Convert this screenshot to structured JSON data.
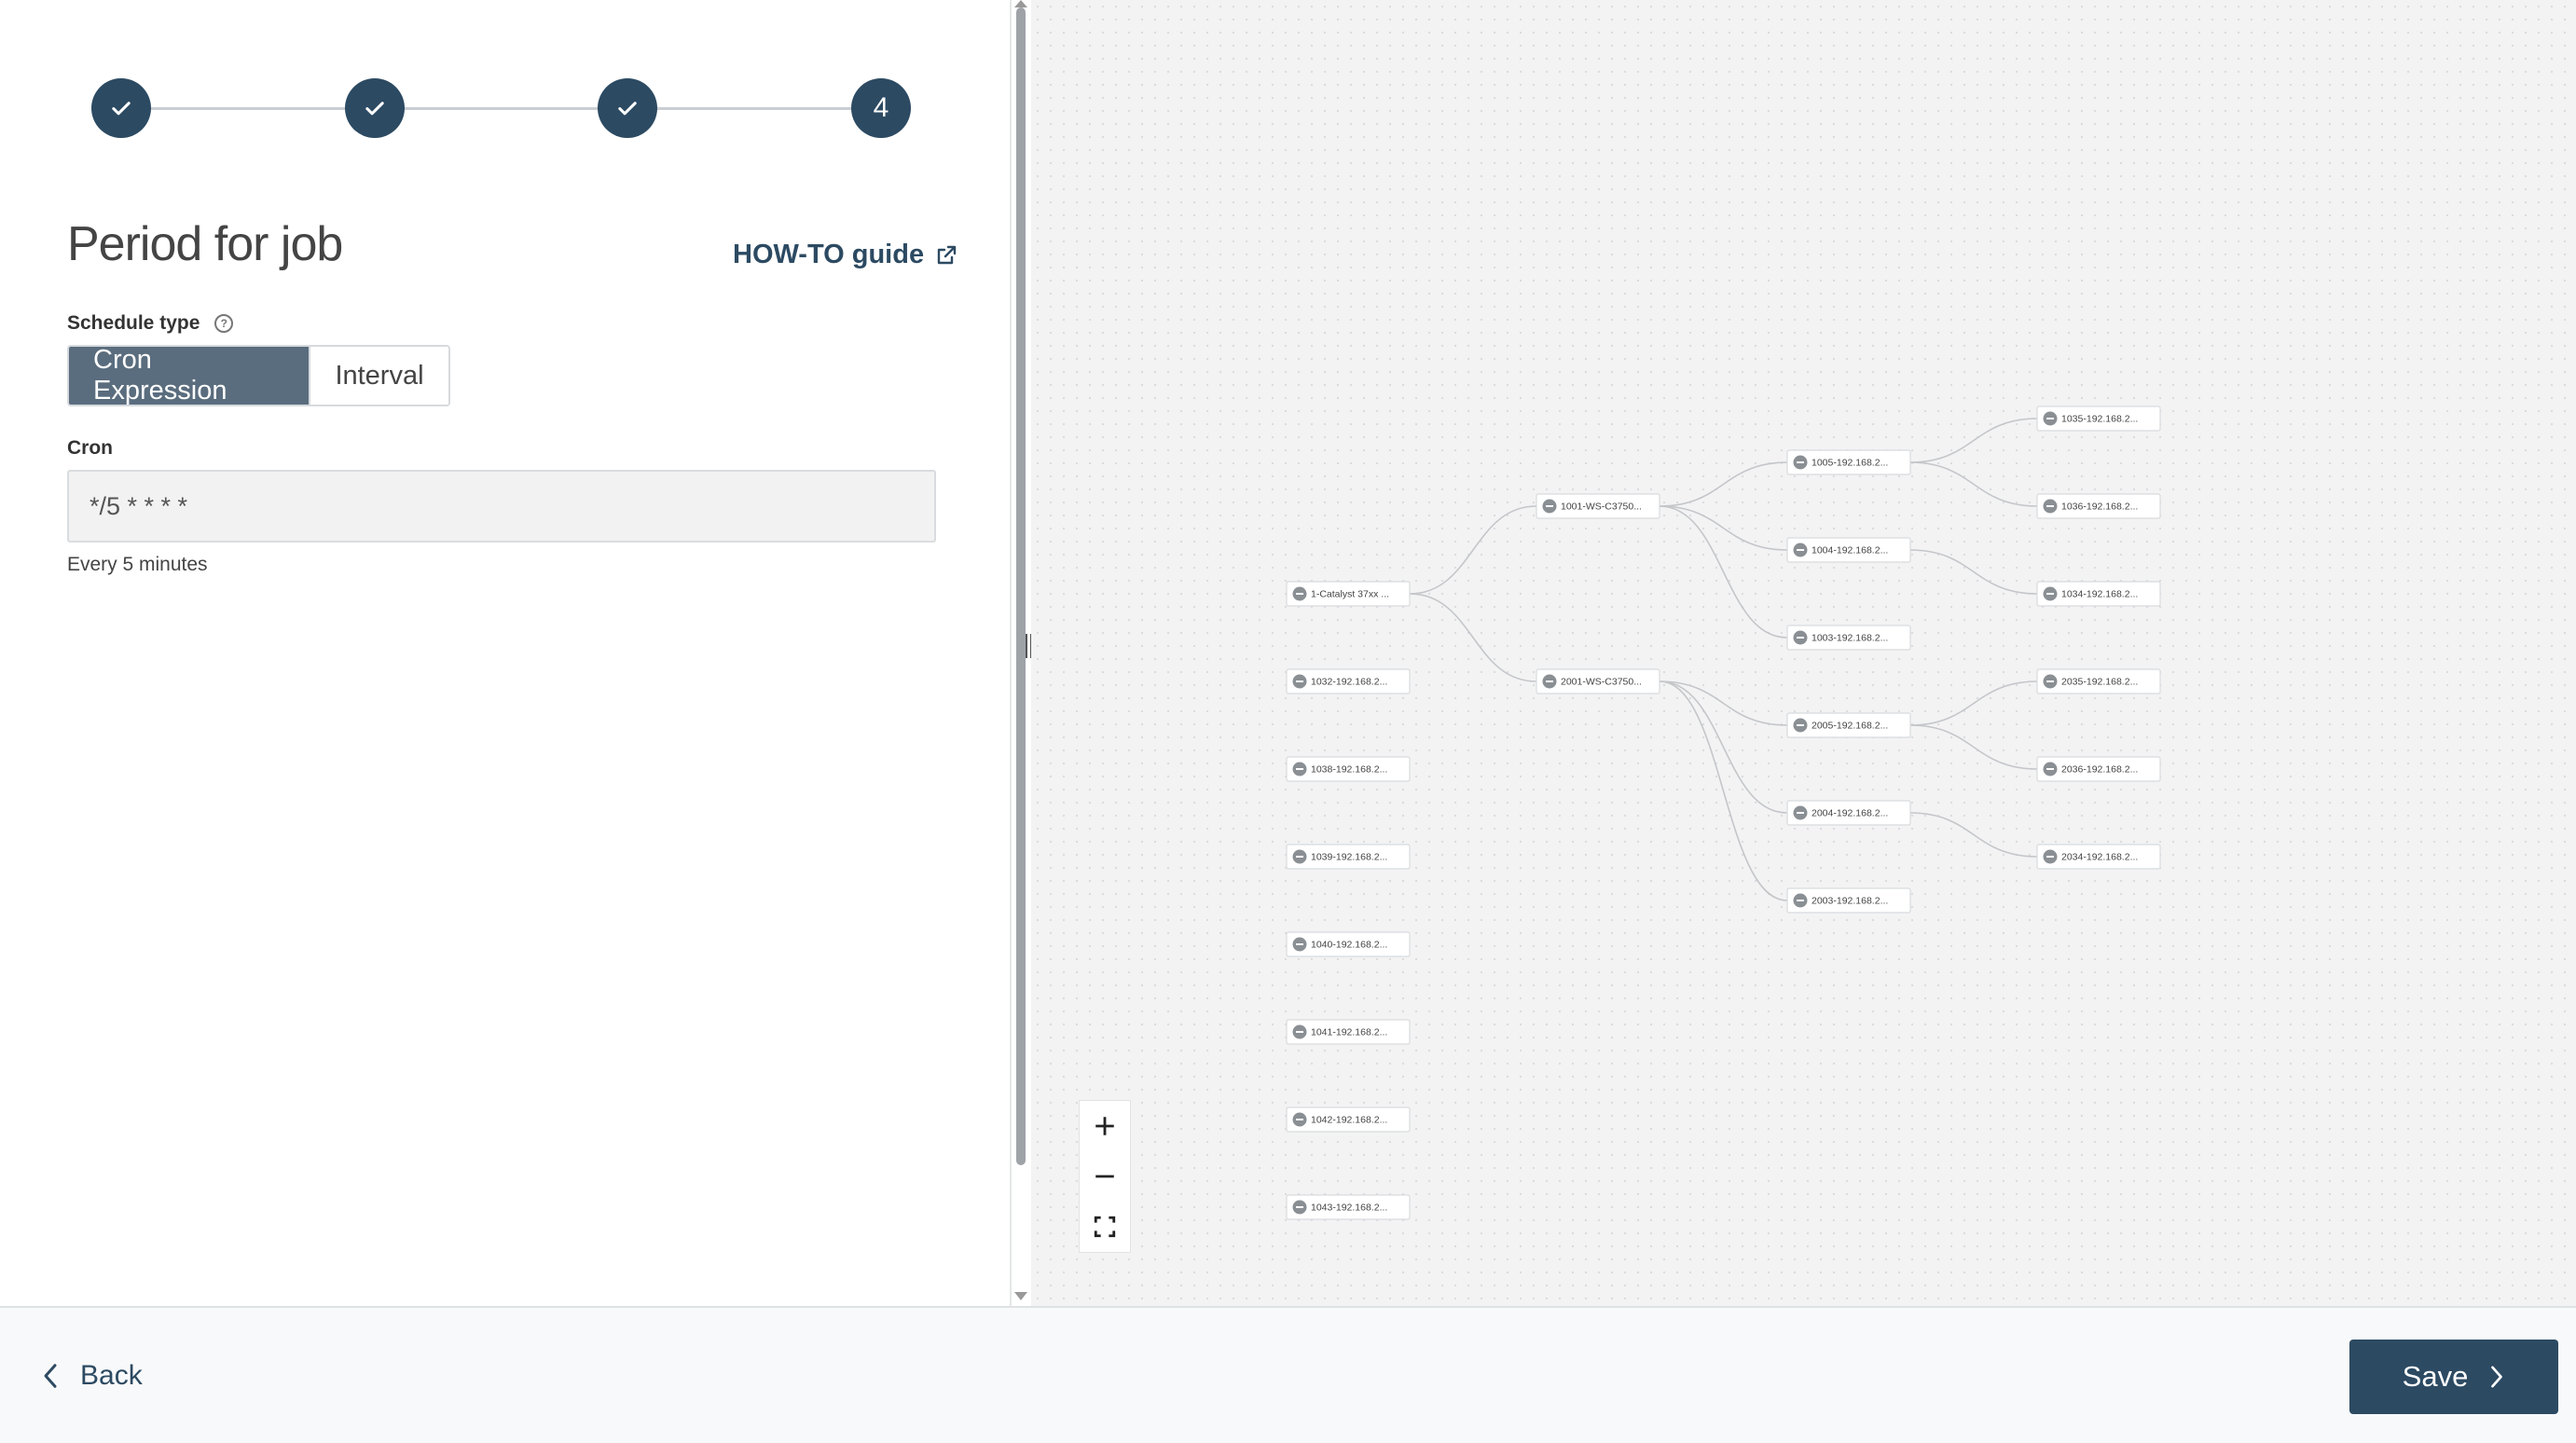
{
  "stepper": {
    "steps": [
      {
        "state": "done",
        "icon": "check-icon"
      },
      {
        "state": "done",
        "icon": "check-icon"
      },
      {
        "state": "done",
        "icon": "check-icon"
      },
      {
        "state": "current",
        "number": "4"
      }
    ]
  },
  "form": {
    "title": "Period for job",
    "howto_label": "HOW-TO guide",
    "schedule_type_label": "Schedule type",
    "schedule_options": [
      "Cron Expression",
      "Interval"
    ],
    "schedule_selected": "Cron Expression",
    "cron_label": "Cron",
    "cron_value": "*/5 * * * *",
    "cron_hint": "Every 5 minutes"
  },
  "graph": {
    "nodes": [
      {
        "id": "root",
        "label": "1-Catalyst 37xx ...",
        "col": 0,
        "row": 2
      },
      {
        "id": "s1",
        "label": "1001-WS-C3750...",
        "col": 1,
        "row": 1
      },
      {
        "id": "s2",
        "label": "2001-WS-C3750...",
        "col": 1,
        "row": 3
      },
      {
        "id": "a1",
        "label": "1005-192.168.2...",
        "col": 2,
        "row": 0.5
      },
      {
        "id": "a2",
        "label": "1004-192.168.2...",
        "col": 2,
        "row": 1.5
      },
      {
        "id": "a3",
        "label": "1003-192.168.2...",
        "col": 2,
        "row": 2.5
      },
      {
        "id": "a4",
        "label": "2005-192.168.2...",
        "col": 2,
        "row": 3.5
      },
      {
        "id": "a5",
        "label": "2004-192.168.2...",
        "col": 2,
        "row": 4.5
      },
      {
        "id": "a6",
        "label": "2003-192.168.2...",
        "col": 2,
        "row": 5.5
      },
      {
        "id": "b1",
        "label": "1035-192.168.2...",
        "col": 3,
        "row": 0
      },
      {
        "id": "b2",
        "label": "1036-192.168.2...",
        "col": 3,
        "row": 1
      },
      {
        "id": "b3",
        "label": "1034-192.168.2...",
        "col": 3,
        "row": 2
      },
      {
        "id": "b4",
        "label": "2035-192.168.2...",
        "col": 3,
        "row": 3
      },
      {
        "id": "b5",
        "label": "2036-192.168.2...",
        "col": 3,
        "row": 4
      },
      {
        "id": "b6",
        "label": "2034-192.168.2...",
        "col": 3,
        "row": 5
      },
      {
        "id": "o1",
        "label": "1032-192.168.2...",
        "col": 0,
        "row": 3
      },
      {
        "id": "o2",
        "label": "1038-192.168.2...",
        "col": 0,
        "row": 4
      },
      {
        "id": "o3",
        "label": "1039-192.168.2...",
        "col": 0,
        "row": 5
      },
      {
        "id": "o4",
        "label": "1040-192.168.2...",
        "col": 0,
        "row": 6
      },
      {
        "id": "o5",
        "label": "1041-192.168.2...",
        "col": 0,
        "row": 7
      },
      {
        "id": "o6",
        "label": "1042-192.168.2...",
        "col": 0,
        "row": 8
      },
      {
        "id": "o7",
        "label": "1043-192.168.2...",
        "col": 0,
        "row": 9
      }
    ],
    "edges": [
      [
        "root",
        "s1"
      ],
      [
        "root",
        "s2"
      ],
      [
        "s1",
        "a1"
      ],
      [
        "s1",
        "a2"
      ],
      [
        "s1",
        "a3"
      ],
      [
        "s2",
        "a4"
      ],
      [
        "s2",
        "a5"
      ],
      [
        "s2",
        "a6"
      ],
      [
        "a1",
        "b1"
      ],
      [
        "a1",
        "b2"
      ],
      [
        "a2",
        "b3"
      ],
      [
        "a4",
        "b4"
      ],
      [
        "a4",
        "b5"
      ],
      [
        "a5",
        "b6"
      ]
    ]
  },
  "zoom": {
    "icons": [
      "plus-icon",
      "minus-icon",
      "fit-screen-icon"
    ]
  },
  "footer": {
    "back_label": "Back",
    "save_label": "Save"
  },
  "colors": {
    "primary": "#2c4a62",
    "segment_active": "#5a6d7e",
    "graph_bg": "#f3f3f4"
  }
}
